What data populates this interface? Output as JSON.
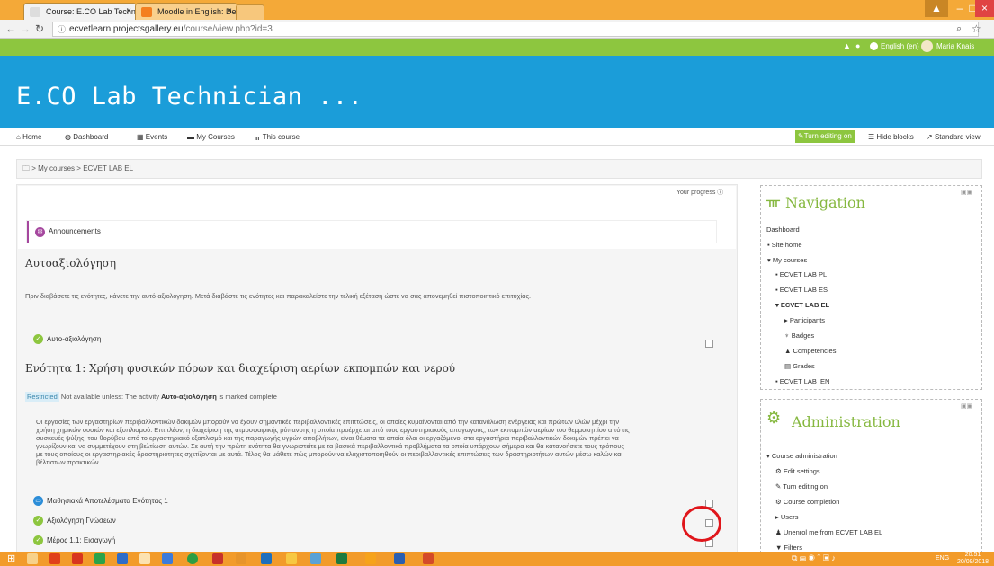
{
  "browser": {
    "tabs": [
      {
        "title": "Course: E.CO Lab Technic",
        "close": "×"
      },
      {
        "title": "Moodle in English: Delet",
        "close": "×"
      }
    ],
    "url_host": "ecvetlearn.projectsgallery.eu",
    "url_path": "/course/view.php?id=3",
    "window_buttons": [
      "▁",
      "–",
      "□",
      "×"
    ]
  },
  "topbar": {
    "language": "English (en)",
    "user": "Maria Knais"
  },
  "site": {
    "name": "E.CO Lab Technician ..."
  },
  "navbar": {
    "items": [
      "Home",
      "Dashboard",
      "Events",
      "My Courses",
      "This course"
    ],
    "turn_editing": "Turn editing on",
    "hide_blocks": "Hide blocks",
    "standard_view": "Standard view"
  },
  "breadcrumb": {
    "my_courses": "My courses",
    "course": "ECVET LAB EL",
    "sep": ">"
  },
  "main": {
    "progress": "Your progress",
    "announcements": "Announcements",
    "section0": {
      "title": "Αυτοαξιολόγηση",
      "text": "Πριν διαβάσετε τις ενότητες, κάνετε την αυτό-αξιολόγηση. Μετά διαβάστε τις ενότητες και παρακαλείστε την τελική εξέταση ώστε να σας απονεμηθεί πιστοποιητικό επιτυχίας.",
      "activity": "Αυτο-αξιολόγηση"
    },
    "section1": {
      "title": "Ενότητα 1: Χρήση φυσικών πόρων και διαχείριση αερίων εκπομπών και νερού",
      "restricted_badge": "Restricted",
      "restricted_pre": "Not available unless: The activity",
      "restricted_bold": "Αυτο-αξιολόγηση",
      "restricted_post": "is marked complete",
      "para": [
        "Οι εργασίες των εργαστηρίων περιβαλλοντικών δοκιμών μπορούν να έχουν σημαντικές περιβαλλοντικές επιπτώσεις, οι οποίες κυμαίνονται από την κατανάλωση ενέργειας και πρώτων υλών μέχρι την",
        "χρήση χημικών ουσιών και εξοπλισμού. Επιπλέον, η διαχείριση της ατμοσφαιρικής ρύπανσης η οποία προέρχεται από τους εργαστηριακούς απαγωγούς, των εκπομπών αερίων του θερμοκηπίου από τις",
        "συσκευές ψύξης, του θορύβου από το εργαστηριακό εξοπλισμό και της παραγωγής υγρών αποβλήτων, είναι θέματα τα οποία όλοι οι εργαζόμενοι στα εργαστήρια περιβαλλοντικών δοκιμών πρέπει να",
        "γνωρίζουν και να συμμετέχουν στη βελτίωση αυτών. Σε αυτή την πρώτη ενότητα θα γνωριστείτε με τα βασικά περιβαλλοντικά προβλήματα τα οποία υπάρχουν σήμερα και θα κατανοήσετε τους τρόπους",
        "με τους οποίους οι εργαστηριακές δραστηριότητες σχετίζονται με αυτά. Τέλος θα μάθετε πώς μπορούν να ελαχιστοποιηθούν οι περιβαλλοντικές επιπτώσεις των δραστηριοτήτων αυτών μέσω καλών και",
        "βέλτιστων πρακτικών."
      ],
      "activities": [
        "Μαθησιακά Αποτελέσματα Ενότητας 1",
        "Αξιολόγηση Γνώσεων",
        "Μέρος 1.1: Εισαγωγή"
      ]
    }
  },
  "navigation": {
    "title": "Navigation",
    "items": [
      "Dashboard",
      "Site home",
      "My courses",
      "ECVET LAB PL",
      "ECVET LAB ES",
      "ECVET LAB EL",
      "Participants",
      "Badges",
      "Competencies",
      "Grades",
      "ECVET LAB_EN"
    ]
  },
  "administration": {
    "title": "Administration",
    "items": [
      "Course administration",
      "Edit settings",
      "Turn editing on",
      "Course completion",
      "Users",
      "Unenrol me from ECVET LAB EL",
      "Filters"
    ]
  },
  "taskbar": {
    "lang": "ENG",
    "time": "20:51",
    "date": "20/09/2018"
  },
  "colors": {
    "orange": "#f4a938",
    "green": "#8dc63f",
    "blue": "#1b9dd9",
    "annotation": "#e0161b"
  }
}
